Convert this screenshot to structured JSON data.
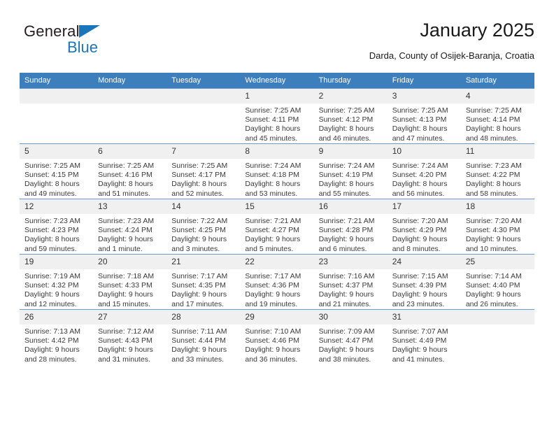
{
  "logo": {
    "word_one": "General",
    "word_two": "Blue",
    "triangle_color": "#1b75bb",
    "general_color": "#231f20"
  },
  "header": {
    "title": "January 2025",
    "subtitle": "Darda, County of Osijek-Baranja, Croatia"
  },
  "theme": {
    "header_row_bg": "#3d7ebd",
    "header_row_text": "#ffffff",
    "daynum_bg": "#f0f0f0",
    "cell_border": "#6a9ad0"
  },
  "weekdays": [
    "Sunday",
    "Monday",
    "Tuesday",
    "Wednesday",
    "Thursday",
    "Friday",
    "Saturday"
  ],
  "weeks": [
    [
      {
        "day": "",
        "empty": true,
        "sunrise": "",
        "sunset": "",
        "daylight_line1": "",
        "daylight_line2": ""
      },
      {
        "day": "",
        "empty": true,
        "sunrise": "",
        "sunset": "",
        "daylight_line1": "",
        "daylight_line2": ""
      },
      {
        "day": "",
        "empty": true,
        "sunrise": "",
        "sunset": "",
        "daylight_line1": "",
        "daylight_line2": ""
      },
      {
        "day": "1",
        "empty": false,
        "sunrise": "Sunrise: 7:25 AM",
        "sunset": "Sunset: 4:11 PM",
        "daylight_line1": "Daylight: 8 hours",
        "daylight_line2": "and 45 minutes."
      },
      {
        "day": "2",
        "empty": false,
        "sunrise": "Sunrise: 7:25 AM",
        "sunset": "Sunset: 4:12 PM",
        "daylight_line1": "Daylight: 8 hours",
        "daylight_line2": "and 46 minutes."
      },
      {
        "day": "3",
        "empty": false,
        "sunrise": "Sunrise: 7:25 AM",
        "sunset": "Sunset: 4:13 PM",
        "daylight_line1": "Daylight: 8 hours",
        "daylight_line2": "and 47 minutes."
      },
      {
        "day": "4",
        "empty": false,
        "sunrise": "Sunrise: 7:25 AM",
        "sunset": "Sunset: 4:14 PM",
        "daylight_line1": "Daylight: 8 hours",
        "daylight_line2": "and 48 minutes."
      }
    ],
    [
      {
        "day": "5",
        "empty": false,
        "sunrise": "Sunrise: 7:25 AM",
        "sunset": "Sunset: 4:15 PM",
        "daylight_line1": "Daylight: 8 hours",
        "daylight_line2": "and 49 minutes."
      },
      {
        "day": "6",
        "empty": false,
        "sunrise": "Sunrise: 7:25 AM",
        "sunset": "Sunset: 4:16 PM",
        "daylight_line1": "Daylight: 8 hours",
        "daylight_line2": "and 51 minutes."
      },
      {
        "day": "7",
        "empty": false,
        "sunrise": "Sunrise: 7:25 AM",
        "sunset": "Sunset: 4:17 PM",
        "daylight_line1": "Daylight: 8 hours",
        "daylight_line2": "and 52 minutes."
      },
      {
        "day": "8",
        "empty": false,
        "sunrise": "Sunrise: 7:24 AM",
        "sunset": "Sunset: 4:18 PM",
        "daylight_line1": "Daylight: 8 hours",
        "daylight_line2": "and 53 minutes."
      },
      {
        "day": "9",
        "empty": false,
        "sunrise": "Sunrise: 7:24 AM",
        "sunset": "Sunset: 4:19 PM",
        "daylight_line1": "Daylight: 8 hours",
        "daylight_line2": "and 55 minutes."
      },
      {
        "day": "10",
        "empty": false,
        "sunrise": "Sunrise: 7:24 AM",
        "sunset": "Sunset: 4:20 PM",
        "daylight_line1": "Daylight: 8 hours",
        "daylight_line2": "and 56 minutes."
      },
      {
        "day": "11",
        "empty": false,
        "sunrise": "Sunrise: 7:23 AM",
        "sunset": "Sunset: 4:22 PM",
        "daylight_line1": "Daylight: 8 hours",
        "daylight_line2": "and 58 minutes."
      }
    ],
    [
      {
        "day": "12",
        "empty": false,
        "sunrise": "Sunrise: 7:23 AM",
        "sunset": "Sunset: 4:23 PM",
        "daylight_line1": "Daylight: 8 hours",
        "daylight_line2": "and 59 minutes."
      },
      {
        "day": "13",
        "empty": false,
        "sunrise": "Sunrise: 7:23 AM",
        "sunset": "Sunset: 4:24 PM",
        "daylight_line1": "Daylight: 9 hours",
        "daylight_line2": "and 1 minute."
      },
      {
        "day": "14",
        "empty": false,
        "sunrise": "Sunrise: 7:22 AM",
        "sunset": "Sunset: 4:25 PM",
        "daylight_line1": "Daylight: 9 hours",
        "daylight_line2": "and 3 minutes."
      },
      {
        "day": "15",
        "empty": false,
        "sunrise": "Sunrise: 7:21 AM",
        "sunset": "Sunset: 4:27 PM",
        "daylight_line1": "Daylight: 9 hours",
        "daylight_line2": "and 5 minutes."
      },
      {
        "day": "16",
        "empty": false,
        "sunrise": "Sunrise: 7:21 AM",
        "sunset": "Sunset: 4:28 PM",
        "daylight_line1": "Daylight: 9 hours",
        "daylight_line2": "and 6 minutes."
      },
      {
        "day": "17",
        "empty": false,
        "sunrise": "Sunrise: 7:20 AM",
        "sunset": "Sunset: 4:29 PM",
        "daylight_line1": "Daylight: 9 hours",
        "daylight_line2": "and 8 minutes."
      },
      {
        "day": "18",
        "empty": false,
        "sunrise": "Sunrise: 7:20 AM",
        "sunset": "Sunset: 4:30 PM",
        "daylight_line1": "Daylight: 9 hours",
        "daylight_line2": "and 10 minutes."
      }
    ],
    [
      {
        "day": "19",
        "empty": false,
        "sunrise": "Sunrise: 7:19 AM",
        "sunset": "Sunset: 4:32 PM",
        "daylight_line1": "Daylight: 9 hours",
        "daylight_line2": "and 12 minutes."
      },
      {
        "day": "20",
        "empty": false,
        "sunrise": "Sunrise: 7:18 AM",
        "sunset": "Sunset: 4:33 PM",
        "daylight_line1": "Daylight: 9 hours",
        "daylight_line2": "and 15 minutes."
      },
      {
        "day": "21",
        "empty": false,
        "sunrise": "Sunrise: 7:17 AM",
        "sunset": "Sunset: 4:35 PM",
        "daylight_line1": "Daylight: 9 hours",
        "daylight_line2": "and 17 minutes."
      },
      {
        "day": "22",
        "empty": false,
        "sunrise": "Sunrise: 7:17 AM",
        "sunset": "Sunset: 4:36 PM",
        "daylight_line1": "Daylight: 9 hours",
        "daylight_line2": "and 19 minutes."
      },
      {
        "day": "23",
        "empty": false,
        "sunrise": "Sunrise: 7:16 AM",
        "sunset": "Sunset: 4:37 PM",
        "daylight_line1": "Daylight: 9 hours",
        "daylight_line2": "and 21 minutes."
      },
      {
        "day": "24",
        "empty": false,
        "sunrise": "Sunrise: 7:15 AM",
        "sunset": "Sunset: 4:39 PM",
        "daylight_line1": "Daylight: 9 hours",
        "daylight_line2": "and 23 minutes."
      },
      {
        "day": "25",
        "empty": false,
        "sunrise": "Sunrise: 7:14 AM",
        "sunset": "Sunset: 4:40 PM",
        "daylight_line1": "Daylight: 9 hours",
        "daylight_line2": "and 26 minutes."
      }
    ],
    [
      {
        "day": "26",
        "empty": false,
        "sunrise": "Sunrise: 7:13 AM",
        "sunset": "Sunset: 4:42 PM",
        "daylight_line1": "Daylight: 9 hours",
        "daylight_line2": "and 28 minutes."
      },
      {
        "day": "27",
        "empty": false,
        "sunrise": "Sunrise: 7:12 AM",
        "sunset": "Sunset: 4:43 PM",
        "daylight_line1": "Daylight: 9 hours",
        "daylight_line2": "and 31 minutes."
      },
      {
        "day": "28",
        "empty": false,
        "sunrise": "Sunrise: 7:11 AM",
        "sunset": "Sunset: 4:44 PM",
        "daylight_line1": "Daylight: 9 hours",
        "daylight_line2": "and 33 minutes."
      },
      {
        "day": "29",
        "empty": false,
        "sunrise": "Sunrise: 7:10 AM",
        "sunset": "Sunset: 4:46 PM",
        "daylight_line1": "Daylight: 9 hours",
        "daylight_line2": "and 36 minutes."
      },
      {
        "day": "30",
        "empty": false,
        "sunrise": "Sunrise: 7:09 AM",
        "sunset": "Sunset: 4:47 PM",
        "daylight_line1": "Daylight: 9 hours",
        "daylight_line2": "and 38 minutes."
      },
      {
        "day": "31",
        "empty": false,
        "sunrise": "Sunrise: 7:07 AM",
        "sunset": "Sunset: 4:49 PM",
        "daylight_line1": "Daylight: 9 hours",
        "daylight_line2": "and 41 minutes."
      },
      {
        "day": "",
        "empty": true,
        "sunrise": "",
        "sunset": "",
        "daylight_line1": "",
        "daylight_line2": ""
      }
    ]
  ]
}
